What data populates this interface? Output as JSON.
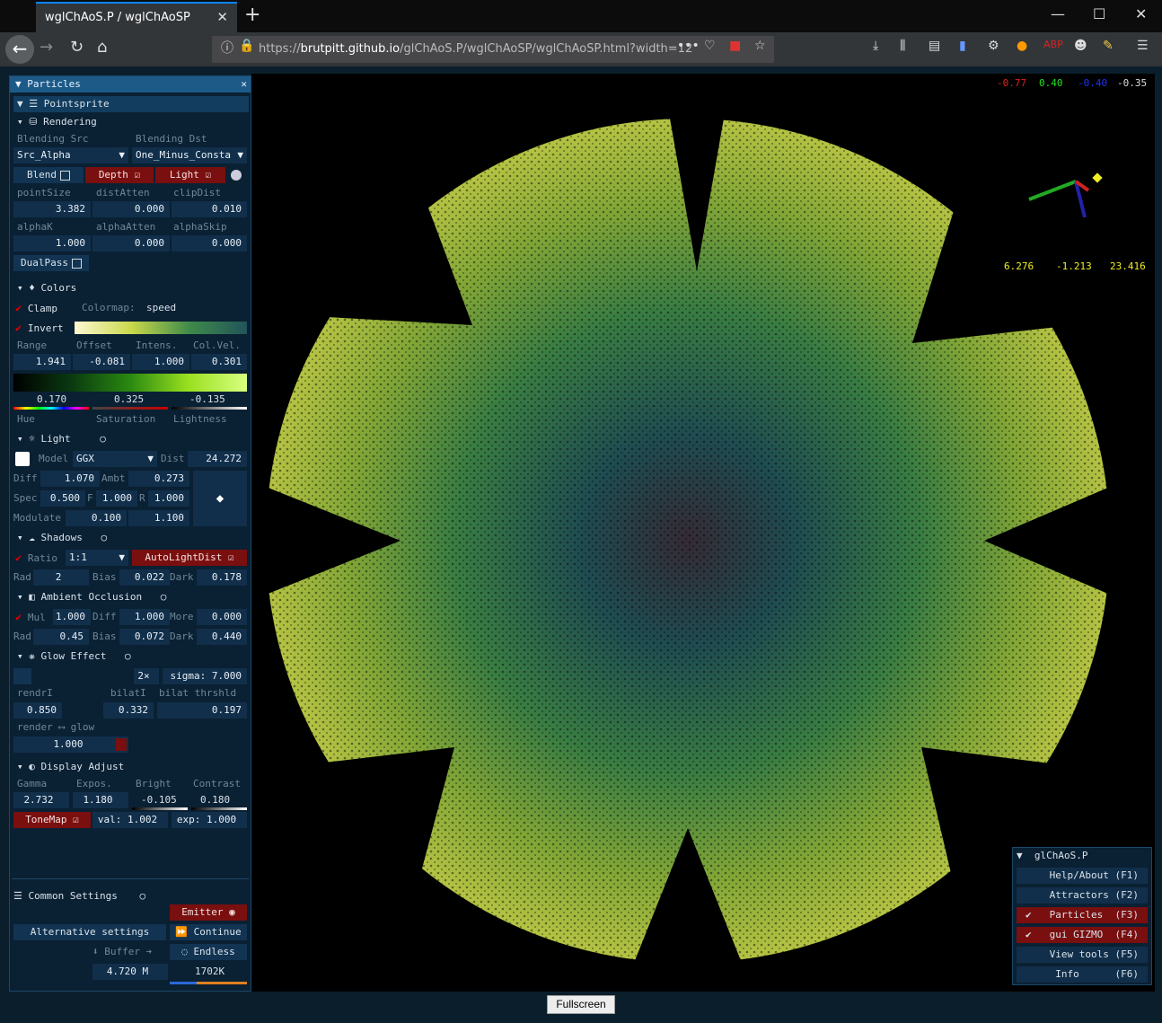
{
  "browser": {
    "tab_title": "wglChAoS.P / wglChAoSP",
    "url_prefix": "https://",
    "url_host": "brutpitt.github.io",
    "url_path": "/glChAoS.P/wglChAoSP/wglChAoSP.html?width=12"
  },
  "hud": {
    "coord_r": "-0.77",
    "coord_g": "0.40",
    "coord_b": "-0.40",
    "coord_w": "-0.35",
    "pos_x": "6.276",
    "pos_y": "-1.213",
    "pos_z": "23.416"
  },
  "panel": {
    "title": "Particles",
    "pointsprite": "Pointsprite",
    "rendering": "Rendering",
    "blend_src_label": "Blending Src",
    "blend_dst_label": "Blending Dst",
    "blend_src": "Src_Alpha",
    "blend_dst": "One_Minus_Consta",
    "blend": "Blend",
    "depth": "Depth",
    "light": "Light",
    "pointSize_l": "pointSize",
    "distAtten_l": "distAtten",
    "clipDist_l": "clipDist",
    "pointSize": "3.382",
    "distAtten": "0.000",
    "clipDist": "0.010",
    "alphaK_l": "alphaK",
    "alphaAtten_l": "alphaAtten",
    "alphaSkip_l": "alphaSkip",
    "alphaK": "1.000",
    "alphaAtten": "0.000",
    "alphaSkip": "0.000",
    "dualpass": "DualPass",
    "colors": "Colors",
    "clamp": "Clamp",
    "colormap_l": "Colormap:",
    "colormap": "speed",
    "invert": "Invert",
    "range_l": "Range",
    "offset_l": "Offset",
    "intens_l": "Intens.",
    "colvel_l": "Col.Vel.",
    "range": "1.941",
    "offset": "-0.081",
    "intens": "1.000",
    "colvel": "0.301",
    "hue": "0.170",
    "sat": "0.325",
    "lig": "-0.135",
    "hue_l": "Hue",
    "sat_l": "Saturation",
    "lig_l": "Lightness",
    "light_sec": "Light",
    "model_l": "Model",
    "model": "GGX",
    "dist_l": "Dist",
    "dist": "24.272",
    "diff_l": "Diff",
    "diff": "1.070",
    "ambt_l": "Ambt",
    "ambt": "0.273",
    "spec_l": "Spec",
    "spec": "0.500",
    "f_l": "F",
    "f": "1.000",
    "r_l": "R",
    "r": "1.000",
    "modulate_l": "Modulate",
    "mod1": "0.100",
    "mod2": "1.100",
    "shadows": "Shadows",
    "ratio_l": "Ratio",
    "ratio": "1:1",
    "autolight": "AutoLightDist",
    "srad_l": "Rad",
    "srad": "2",
    "sbias_l": "Bias",
    "sbias": "0.022",
    "sdark_l": "Dark",
    "sdark": "0.178",
    "ao": "Ambient Occlusion",
    "mul_l": "Mul",
    "mul": "1.000",
    "aodiff_l": "Diff",
    "aodiff": "1.000",
    "more_l": "More",
    "more": "0.000",
    "aorad_l": "Rad",
    "aorad": "0.45",
    "aobias_l": "Bias",
    "aobias": "0.072",
    "aodark_l": "Dark",
    "aodark": "0.440",
    "glow": "Glow Effect",
    "twox": "2×",
    "sigma": "sigma: 7.000",
    "rendrI_l": "rendrI",
    "bilatI_l": "bilatI",
    "bilat_l": "bilat thrshld",
    "rendrI": "0.850",
    "bilatI": "0.332",
    "bilat": "0.197",
    "render_glow_l": "render ⟷ glow",
    "mix": "1.000",
    "display": "Display Adjust",
    "gamma_l": "Gamma",
    "expos_l": "Expos.",
    "bright_l": "Bright",
    "contrast_l": "Contrast",
    "gamma": "2.732",
    "expos": "1.180",
    "bright": "-0.105",
    "contrast": "0.180",
    "tonemap": "ToneMap",
    "val": "val: 1.002",
    "exp": "exp: 1.000",
    "common": "Common Settings",
    "emitter": "Emitter",
    "alt": "Alternative settings",
    "continue": "Continue",
    "buffer": "Buffer",
    "endless": "Endless",
    "mem": "4.720 M",
    "count": "1702K"
  },
  "menu": {
    "title": "glChAoS.P",
    "items": [
      "Help/About (F1)",
      "Attractors (F2)",
      "Particles  (F3)",
      "gui GIZMO  (F4)",
      "View tools (F5)",
      "Info      (F6)"
    ]
  },
  "fullscreen": "Fullscreen"
}
